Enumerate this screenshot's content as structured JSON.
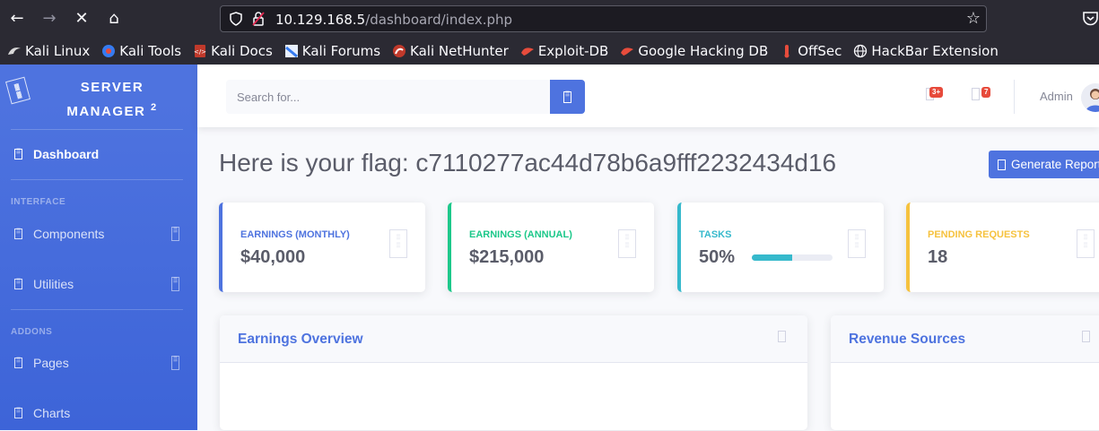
{
  "browser": {
    "url_host": "10.129.168.5",
    "url_path": "/dashboard/index.php",
    "bookmarks": [
      {
        "label": "Kali Linux",
        "icon": "kali-dragon-icon"
      },
      {
        "label": "Kali Tools",
        "icon": "kali-tools-icon"
      },
      {
        "label": "Kali Docs",
        "icon": "kali-docs-icon"
      },
      {
        "label": "Kali Forums",
        "icon": "kali-forums-icon"
      },
      {
        "label": "Kali NetHunter",
        "icon": "nethunter-icon"
      },
      {
        "label": "Exploit-DB",
        "icon": "exploit-db-icon"
      },
      {
        "label": "Google Hacking DB",
        "icon": "ghdb-icon"
      },
      {
        "label": "OffSec",
        "icon": "offsec-icon"
      },
      {
        "label": "HackBar Extension",
        "icon": "globe-icon"
      }
    ]
  },
  "sidebar": {
    "brand_line1": "Server",
    "brand_line2": "Manager",
    "brand_sup": "2",
    "dashboard": "Dashboard",
    "heading_interface": "INTERFACE",
    "components": "Components",
    "utilities": "Utilities",
    "heading_addons": "ADDONS",
    "pages": "Pages",
    "charts": "Charts"
  },
  "topbar": {
    "search_placeholder": "Search for...",
    "alerts_badge": "3+",
    "messages_badge": "7",
    "user_name": "Admin"
  },
  "main": {
    "page_title": "Here is your flag: c7110277ac44d78b6a9fff2232434d16",
    "report_button": "Generate Report",
    "cards": [
      {
        "title": "Earnings (Monthly)",
        "value": "$40,000",
        "color": "#4e73df"
      },
      {
        "title": "Earnings (Annual)",
        "value": "$215,000",
        "color": "#1cc88a"
      },
      {
        "title": "Tasks",
        "value": "50%",
        "color": "#36b9cc",
        "progress": 0.5
      },
      {
        "title": "Pending Requests",
        "value": "18",
        "color": "#f6c23e"
      }
    ],
    "panel_earnings": "Earnings Overview",
    "panel_revenue": "Revenue Sources"
  }
}
